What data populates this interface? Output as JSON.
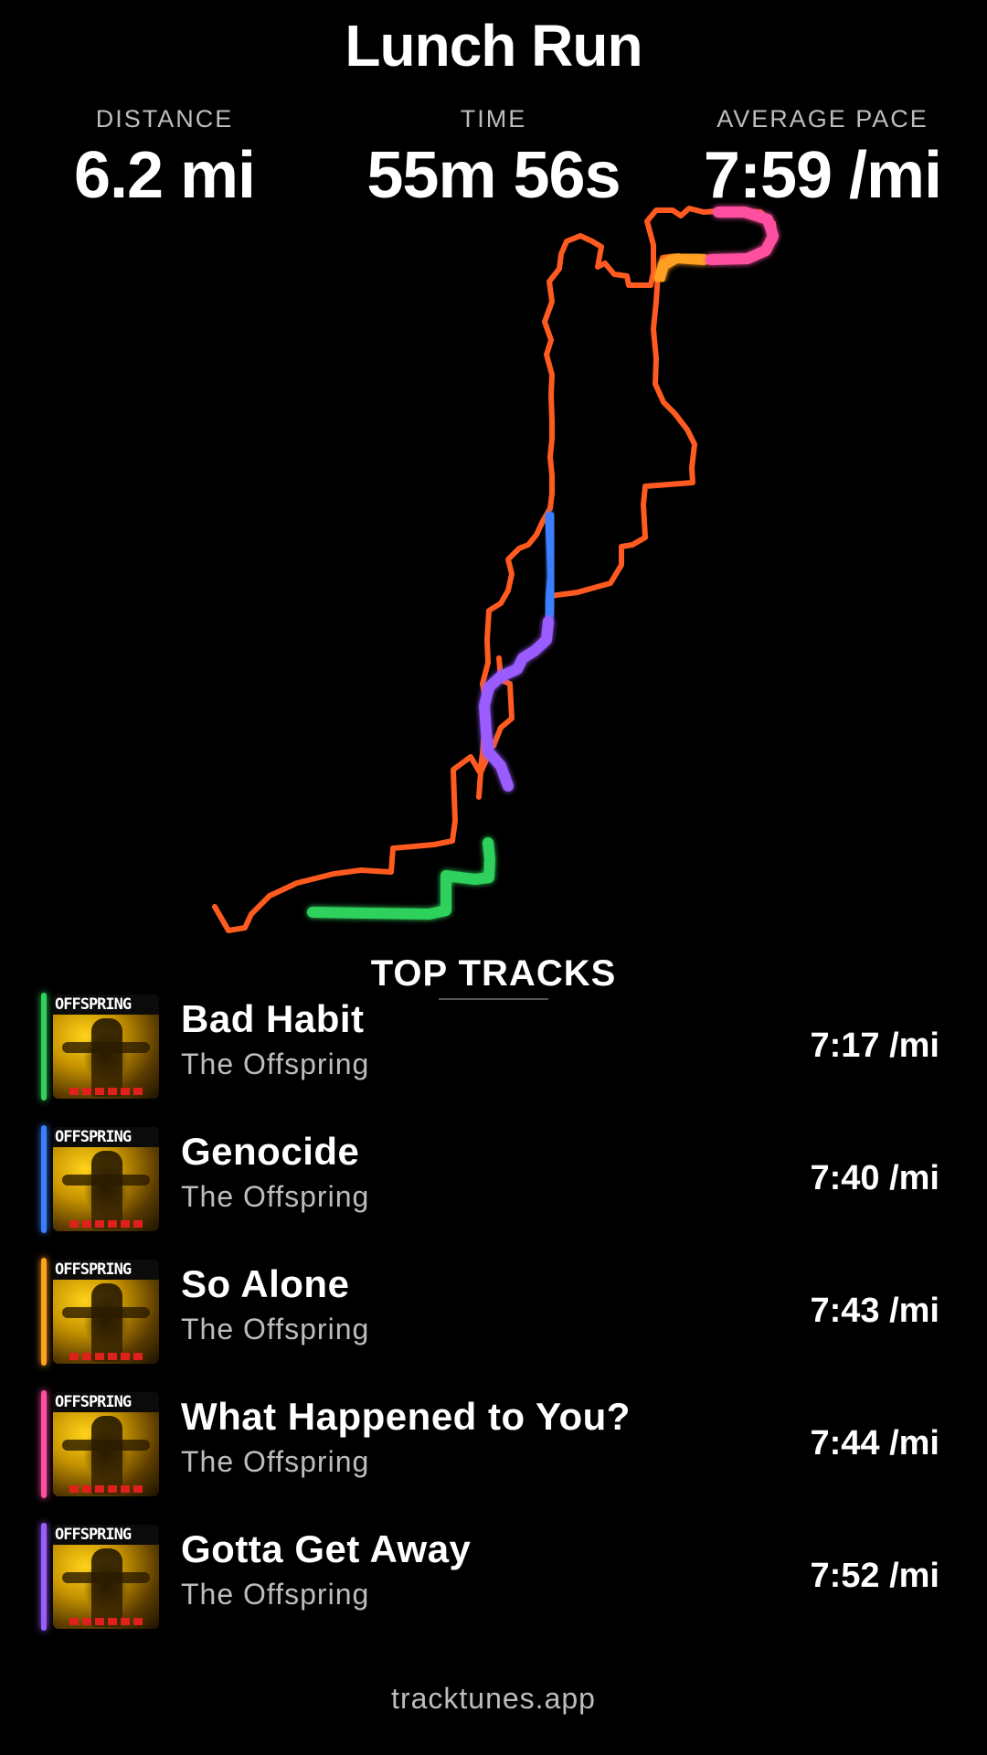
{
  "header": {
    "title": "Lunch Run"
  },
  "stats": {
    "distance": {
      "label": "DISTANCE",
      "value": "6.2 mi"
    },
    "time": {
      "label": "TIME",
      "value": "55m 56s"
    },
    "pace": {
      "label": "AVERAGE PACE",
      "value": "7:59 /mi"
    }
  },
  "map": {
    "route_color": "#ff5a1f"
  },
  "top_tracks": {
    "heading": "TOP TRACKS",
    "items": [
      {
        "title": "Bad Habit",
        "artist": "The Offspring",
        "pace": "7:17 /mi",
        "color": "#2fd15c",
        "album_art_text": "OFFSPRING"
      },
      {
        "title": "Genocide",
        "artist": "The Offspring",
        "pace": "7:40 /mi",
        "color": "#3a7fff",
        "album_art_text": "OFFSPRING"
      },
      {
        "title": "So Alone",
        "artist": "The Offspring",
        "pace": "7:43 /mi",
        "color": "#ffa020",
        "album_art_text": "OFFSPRING"
      },
      {
        "title": "What Happened to You?",
        "artist": "The Offspring",
        "pace": "7:44 /mi",
        "color": "#ff4fa0",
        "album_art_text": "OFFSPRING"
      },
      {
        "title": "Gotta Get Away",
        "artist": "The Offspring",
        "pace": "7:52 /mi",
        "color": "#9a5cff",
        "album_art_text": "OFFSPRING"
      }
    ]
  },
  "footer": {
    "text": "tracktunes.app"
  }
}
